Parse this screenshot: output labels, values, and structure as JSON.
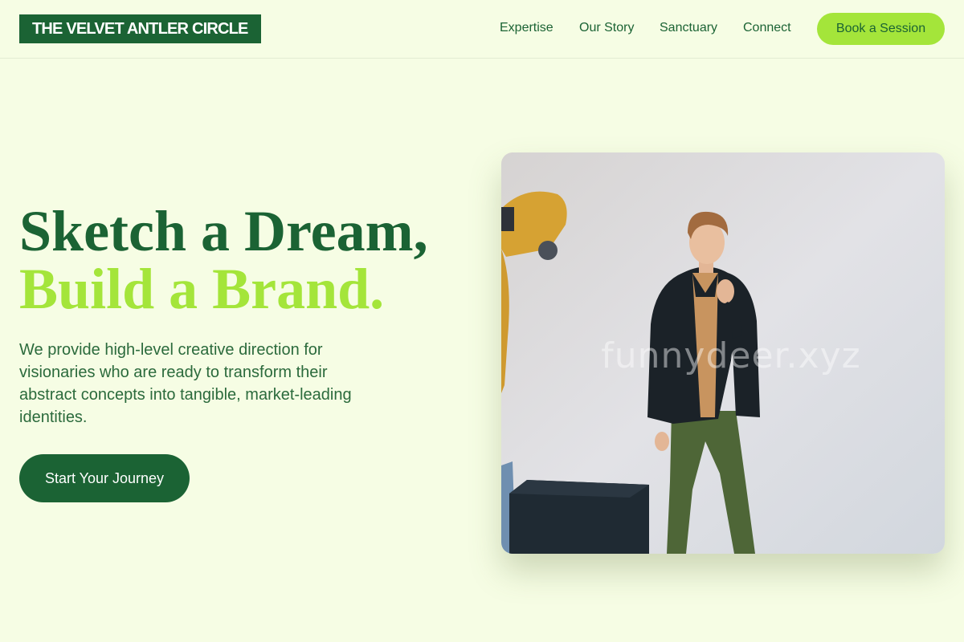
{
  "header": {
    "logo": "THE VELVET ANTLER CIRCLE",
    "nav": [
      "Expertise",
      "Our Story",
      "Sanctuary",
      "Connect"
    ],
    "cta": "Book a Session"
  },
  "hero": {
    "headline_line1": "Sketch a Dream,",
    "headline_line2": "Build a Brand.",
    "description": "We provide high-level creative direction for visionaries who are ready to transform their abstract concepts into tangible, market-leading identities.",
    "cta": "Start Your Journey"
  },
  "image": {
    "watermark": "funnydeer.xyz"
  },
  "colors": {
    "background": "#f6fde4",
    "primary": "#1b6334",
    "accent": "#a4e53a"
  }
}
